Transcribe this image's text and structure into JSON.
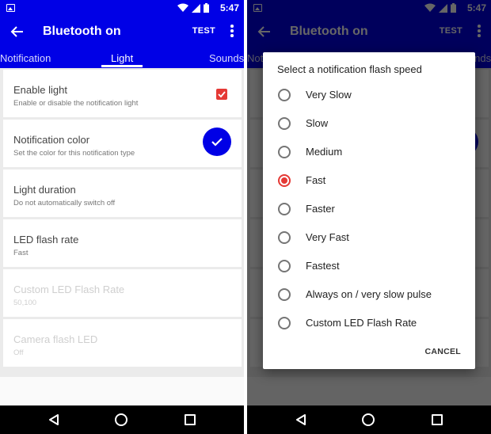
{
  "status_bar": {
    "time": "5:47"
  },
  "app_bar": {
    "title": "Bluetooth on",
    "test_label": "TEST"
  },
  "tabs": [
    {
      "label": "Notification",
      "selected": false
    },
    {
      "label": "Light",
      "selected": true
    },
    {
      "label": "Sounds",
      "selected": false
    }
  ],
  "settings": [
    {
      "title": "Enable light",
      "subtitle": "Enable or disable the notification light",
      "control": "checkbox",
      "checked": true,
      "enabled": true
    },
    {
      "title": "Notification color",
      "subtitle": "Set the color for this notification type",
      "control": "color",
      "color": "#0000e6",
      "enabled": true
    },
    {
      "title": "Light duration",
      "subtitle": "Do not automatically switch off",
      "enabled": true
    },
    {
      "title": "LED flash rate",
      "subtitle": "Fast",
      "enabled": true
    },
    {
      "title": "Custom LED Flash Rate",
      "subtitle": "50,100",
      "enabled": false
    },
    {
      "title": "Camera flash LED",
      "subtitle": "Off",
      "enabled": false
    }
  ],
  "dialog": {
    "title": "Select a notification flash speed",
    "options": [
      {
        "label": "Very Slow",
        "selected": false
      },
      {
        "label": "Slow",
        "selected": false
      },
      {
        "label": "Medium",
        "selected": false
      },
      {
        "label": "Fast",
        "selected": true
      },
      {
        "label": "Faster",
        "selected": false
      },
      {
        "label": "Very Fast",
        "selected": false
      },
      {
        "label": "Fastest",
        "selected": false
      },
      {
        "label": "Always on / very slow pulse",
        "selected": false
      },
      {
        "label": "Custom LED Flash Rate",
        "selected": false
      }
    ],
    "cancel_label": "CANCEL"
  },
  "colors": {
    "primary": "#0000e6",
    "accent": "#e53935",
    "background": "#ebebeb"
  },
  "icons": {
    "status_notification": "image-icon",
    "status_wifi": "wifi-icon",
    "status_signal": "signal-icon",
    "status_battery": "battery-icon",
    "back": "arrow-left-icon",
    "overflow": "more-vert-icon",
    "check": "check-icon",
    "nav_back": "triangle-back-icon",
    "nav_home": "circle-home-icon",
    "nav_recent": "square-recent-icon"
  }
}
